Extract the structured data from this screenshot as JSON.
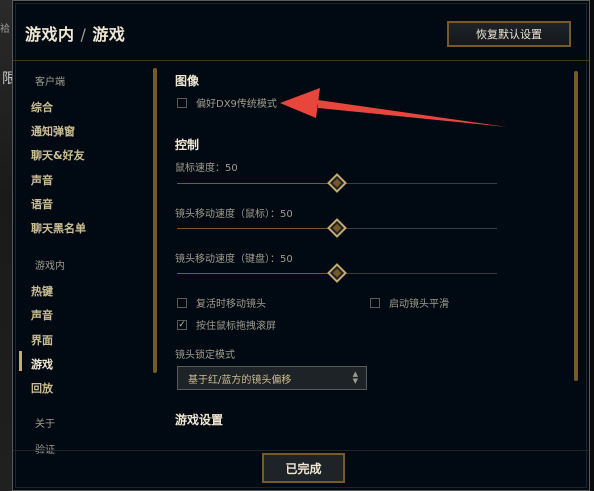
{
  "background": {
    "left_fragment_top": "袷",
    "left_fragment_mid": "限"
  },
  "header": {
    "breadcrumb_parent": "游戏内",
    "separator": "/",
    "breadcrumb_current": "游戏",
    "reset_label": "恢复默认设置"
  },
  "sidebar": {
    "client_section": "客户端",
    "client_items": [
      "综合",
      "通知弹窗",
      "聊天&好友",
      "声音",
      "语音",
      "聊天黑名单"
    ],
    "ingame_section": "游戏内",
    "ingame_items": [
      "热键",
      "声音",
      "界面",
      "游戏",
      "回放"
    ],
    "active_item": "游戏",
    "other_items": [
      "关于",
      "验证"
    ]
  },
  "content": {
    "image_heading": "图像",
    "legacy_dx9": {
      "label": "偏好DX9传统模式",
      "checked": false
    },
    "control_heading": "控制",
    "mouse_speed": {
      "label": "鼠标速度：50",
      "value": 50,
      "max": 100
    },
    "camera_speed_mouse": {
      "label": "镜头移动速度（鼠标）：50",
      "value": 50,
      "max": 100
    },
    "camera_speed_keyboard": {
      "label": "镜头移动速度（键盘）：50",
      "value": 50,
      "max": 100
    },
    "checkboxes": [
      {
        "label": "复活时移动镜头",
        "checked": false
      },
      {
        "label": "启动镜头平滑",
        "checked": false
      },
      {
        "label": "按住鼠标拖拽滚屏",
        "checked": true
      }
    ],
    "lock_mode_label": "镜头锁定模式",
    "lock_mode_value": "基于红/蓝方的镜头偏移",
    "game_settings_heading": "游戏设置"
  },
  "footer": {
    "done_label": "已完成"
  },
  "colors": {
    "gold": "#c8aa6e",
    "gold_dark": "#785a28",
    "arrow_red": "#e8453c"
  },
  "icons": {
    "checkbox_checked": "checkmark-icon",
    "select_arrows": "updown-arrows-icon"
  }
}
